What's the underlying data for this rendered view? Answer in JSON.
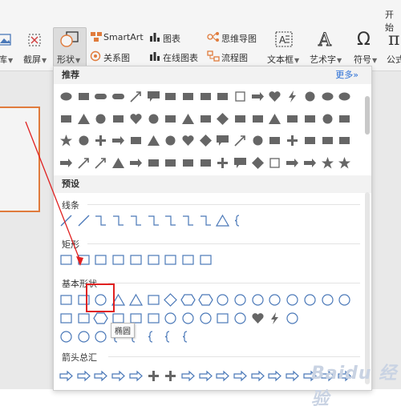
{
  "ribbon": {
    "top_right_label": "开始",
    "buttons": [
      {
        "label": "库"
      },
      {
        "label": "截屏"
      },
      {
        "label": "形状"
      },
      {
        "label": "SmartArt"
      },
      {
        "label": "关系图"
      },
      {
        "label": "图表"
      },
      {
        "label": "在线图表"
      },
      {
        "label": "思维导图"
      },
      {
        "label": "流程图"
      },
      {
        "label": "文本框"
      },
      {
        "label": "艺术字"
      },
      {
        "label": "符号"
      },
      {
        "label": "公式"
      }
    ]
  },
  "shapes_panel": {
    "recommended_header": "推荐",
    "more_link": "更多",
    "presets_header": "预设",
    "categories": [
      {
        "label": "线条"
      },
      {
        "label": "矩形"
      },
      {
        "label": "基本形状"
      },
      {
        "label": "箭头总汇"
      }
    ],
    "tooltip": "椭圆",
    "highlight_color": "#e02020",
    "accent_color": "#4a78b8"
  },
  "watermark": "Baidu 经验"
}
